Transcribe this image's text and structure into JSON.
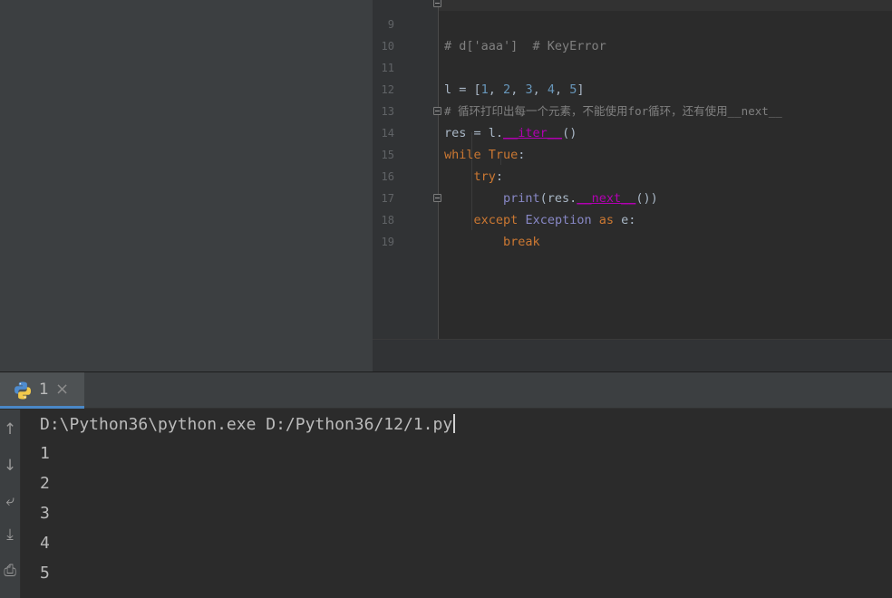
{
  "editor": {
    "lines": [
      {
        "num": "9",
        "code": "# d['aaa']  # KeyError"
      },
      {
        "num": "10",
        "code": ""
      },
      {
        "num": "11",
        "code": "l = [1, 2, 3, 4, 5]"
      },
      {
        "num": "12",
        "code": "# 循环打印出每一个元素，不能使用for循环，还有使用__next__"
      },
      {
        "num": "13",
        "code": "res = l.__iter__()"
      },
      {
        "num": "14",
        "code": "while True:"
      },
      {
        "num": "15",
        "code": "    try:"
      },
      {
        "num": "16",
        "code": "        print(res.__next__())"
      },
      {
        "num": "17",
        "code": "    except Exception as e:"
      },
      {
        "num": "18",
        "code": "        break"
      },
      {
        "num": "19",
        "code": ""
      }
    ]
  },
  "run_panel": {
    "tab_label": "1",
    "tab_close": "×",
    "icon": "python-icon",
    "tools": [
      "up-arrow-icon",
      "down-arrow-icon",
      "soft-wrap-icon",
      "scroll-to-end-icon",
      "print-icon"
    ]
  },
  "console": {
    "command": "D:\\Python36\\python.exe D:/Python36/12/1.py",
    "output": [
      "1",
      "2",
      "3",
      "4",
      "5"
    ]
  },
  "colors": {
    "keyword": "#cc7832",
    "number": "#6897bb",
    "comment": "#808080",
    "magic_method": "#b200b2",
    "builtin": "#8888c6",
    "tab_underline": "#4a88c7"
  }
}
